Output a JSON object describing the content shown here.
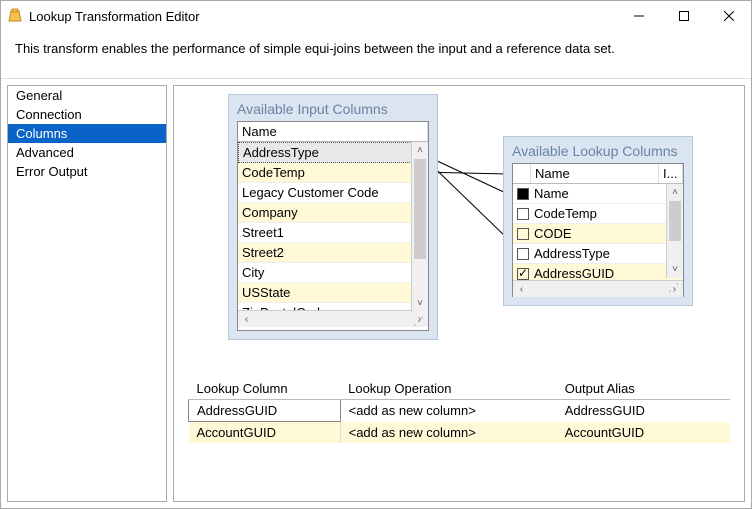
{
  "window": {
    "title": "Lookup Transformation Editor"
  },
  "description": "This transform enables the performance of simple equi-joins between the input and a reference data set.",
  "sidebar": {
    "items": [
      {
        "label": "General"
      },
      {
        "label": "Connection"
      },
      {
        "label": "Columns"
      },
      {
        "label": "Advanced"
      },
      {
        "label": "Error Output"
      }
    ],
    "selected_index": 2
  },
  "input_panel": {
    "title": "Available Input Columns",
    "header": "Name",
    "rows": [
      "AddressType",
      "CodeTemp",
      "Legacy Customer Code",
      "Company",
      "Street1",
      "Street2",
      "City",
      "USState",
      "ZipPostalCode"
    ],
    "selected_index": 0
  },
  "lookup_panel": {
    "title": "Available Lookup Columns",
    "headers": {
      "col1": "Name",
      "col2": "I..."
    },
    "rows": [
      {
        "label": "Name",
        "state": "filled"
      },
      {
        "label": "CodeTemp",
        "state": "empty"
      },
      {
        "label": "CODE",
        "state": "empty"
      },
      {
        "label": "AddressType",
        "state": "empty"
      },
      {
        "label": "AddressGUID",
        "state": "checked"
      }
    ]
  },
  "mapping_table": {
    "headers": {
      "c1": "Lookup Column",
      "c2": "Lookup Operation",
      "c3": "Output Alias"
    },
    "rows": [
      {
        "col": "AddressGUID",
        "op": "<add as new column>",
        "alias": "AddressGUID"
      },
      {
        "col": "AccountGUID",
        "op": "<add as new column>",
        "alias": "AccountGUID"
      }
    ]
  }
}
